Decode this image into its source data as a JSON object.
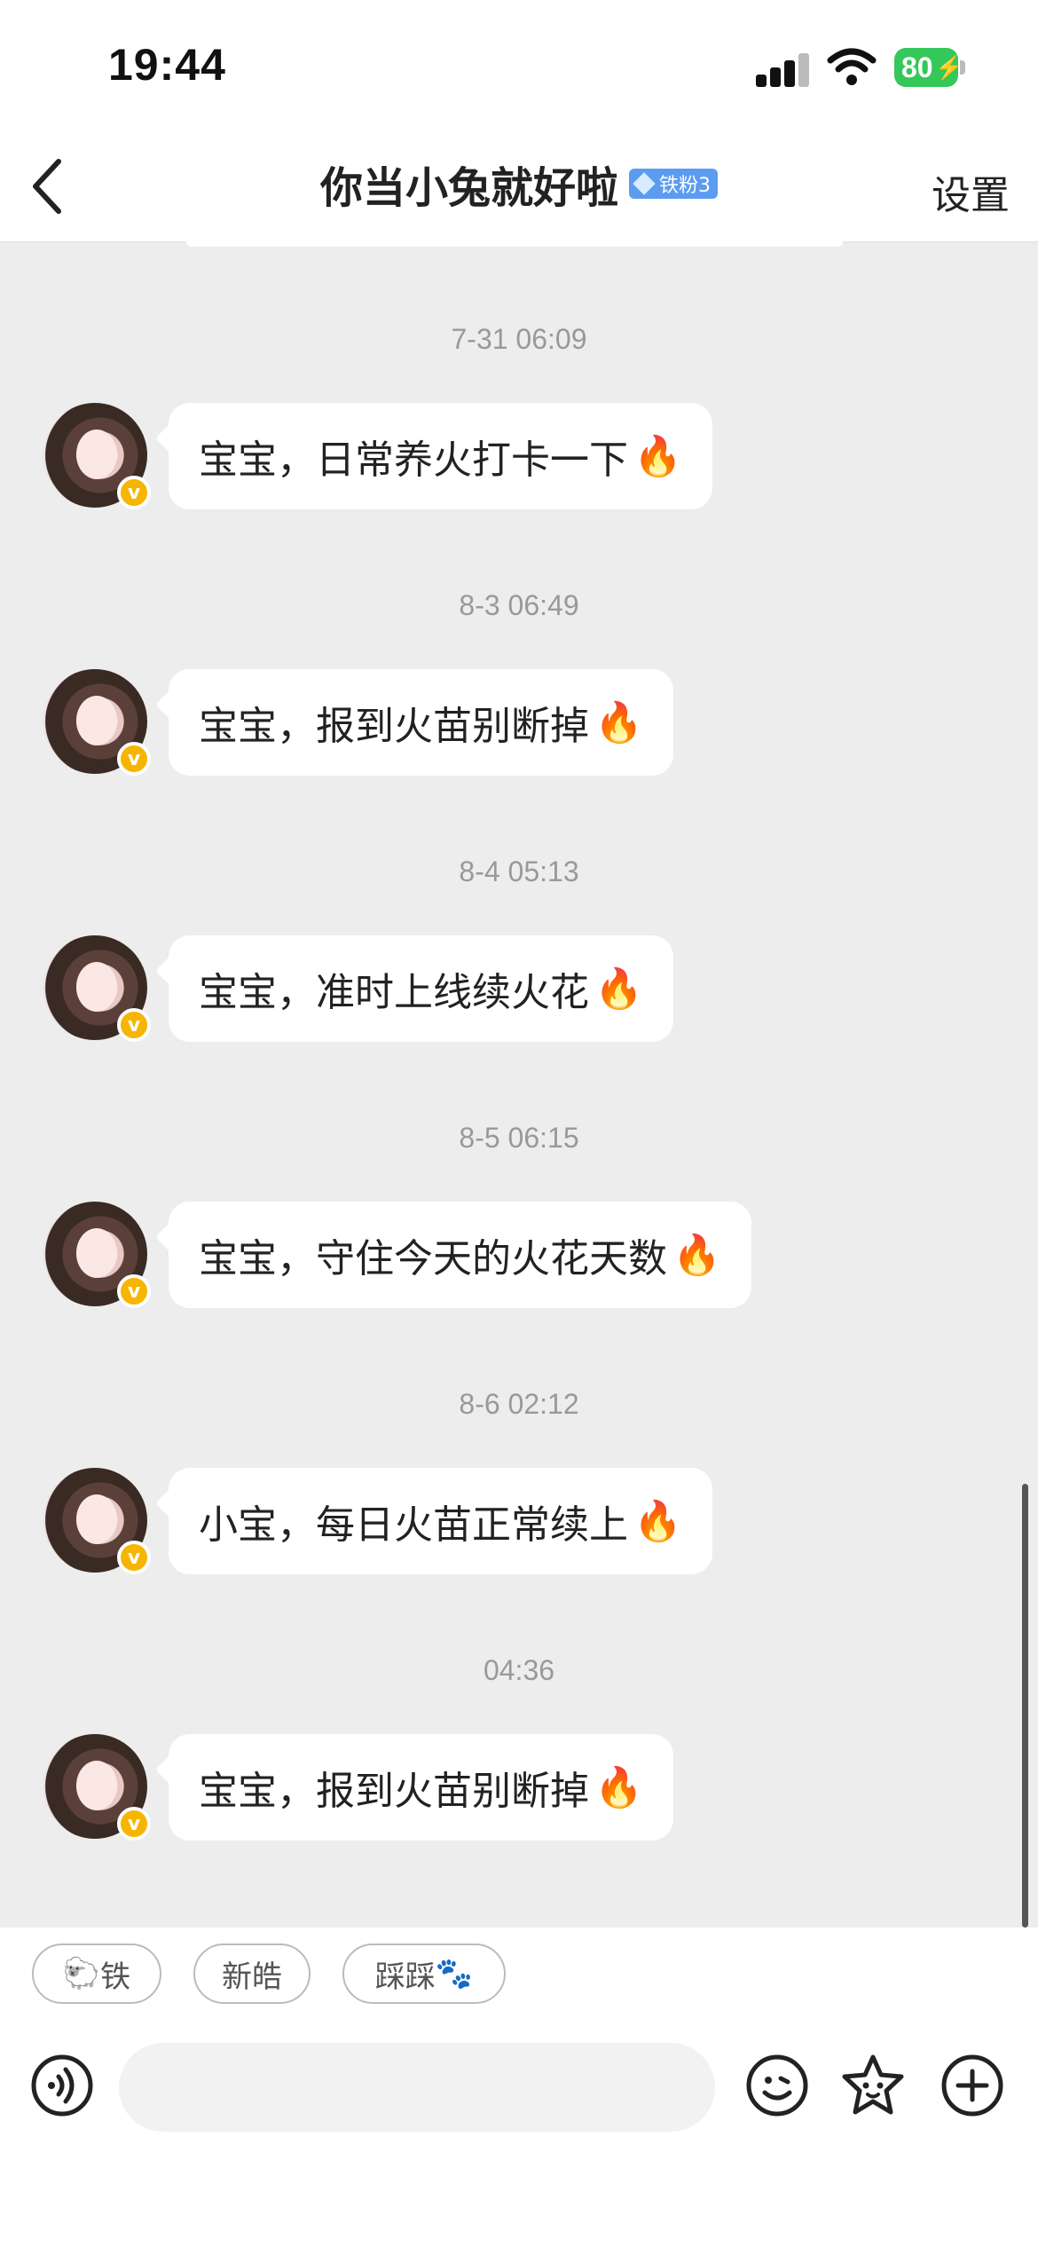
{
  "status_bar": {
    "time": "19:44",
    "battery": "80",
    "icons": [
      "signal-icon",
      "wifi-icon",
      "battery-charging-icon"
    ]
  },
  "nav": {
    "title": "你当小兔就好啦",
    "fan_badge": "铁粉3",
    "settings_label": "设置",
    "badge_color": "#5b9cf0"
  },
  "messages": [
    {
      "timestamp": "7-31 06:09",
      "text": "宝宝，日常养火打卡一下",
      "emoji": "🔥"
    },
    {
      "timestamp": "8-3 06:49",
      "text": "宝宝，报到火苗别断掉",
      "emoji": "🔥"
    },
    {
      "timestamp": "8-4 05:13",
      "text": "宝宝，准时上线续火花",
      "emoji": "🔥"
    },
    {
      "timestamp": "8-5 06:15",
      "text": "宝宝，守住今天的火花天数",
      "emoji": "🔥"
    },
    {
      "timestamp": "8-6 02:12",
      "text": "小宝，每日火苗正常续上",
      "emoji": "🔥"
    },
    {
      "timestamp": "04:36",
      "text": "宝宝，报到火苗别断掉",
      "emoji": "🔥"
    }
  ],
  "quick_replies": [
    {
      "emoji": "🐑",
      "label": "铁"
    },
    {
      "emoji": "",
      "label": "新皓"
    },
    {
      "emoji": "🐾",
      "label": "踩踩"
    }
  ],
  "verified_badge": "v",
  "input": {
    "placeholder": "",
    "icons": [
      "voice-icon",
      "emoji-icon",
      "sticker-icon",
      "plus-icon"
    ]
  }
}
